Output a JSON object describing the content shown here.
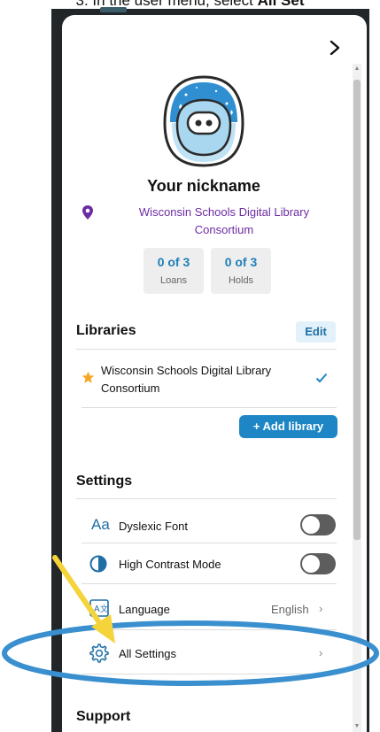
{
  "caption": {
    "prefix": "In the user menu, select ",
    "bold": "All Set"
  },
  "panel": {
    "close_glyph": "chevron-right-icon"
  },
  "profile": {
    "nickname": "Your nickname",
    "home_library": "Wisconsin Schools Digital Library Consortium",
    "loans_value": "0 of 3",
    "loans_label": "Loans",
    "holds_value": "0 of 3",
    "holds_label": "Holds"
  },
  "libraries": {
    "title": "Libraries",
    "edit_label": "Edit",
    "items": [
      {
        "name": "Wisconsin Schools Digital Library Consortium",
        "selected": true
      }
    ],
    "add_label": "+ Add library"
  },
  "settings": {
    "title": "Settings",
    "dyslexic_label": "Dyslexic Font",
    "dyslexic_icon_text": "Aa",
    "dyslexic_on": false,
    "contrast_label": "High Contrast Mode",
    "contrast_on": false,
    "language_label": "Language",
    "language_value": "English",
    "all_settings_label": "All Settings"
  },
  "support": {
    "title": "Support"
  },
  "colors": {
    "accent": "#1f86c5",
    "library_text": "#6d2ba3",
    "annotation_arrow": "#f5d33b",
    "annotation_ellipse": "#3a8fcf"
  }
}
